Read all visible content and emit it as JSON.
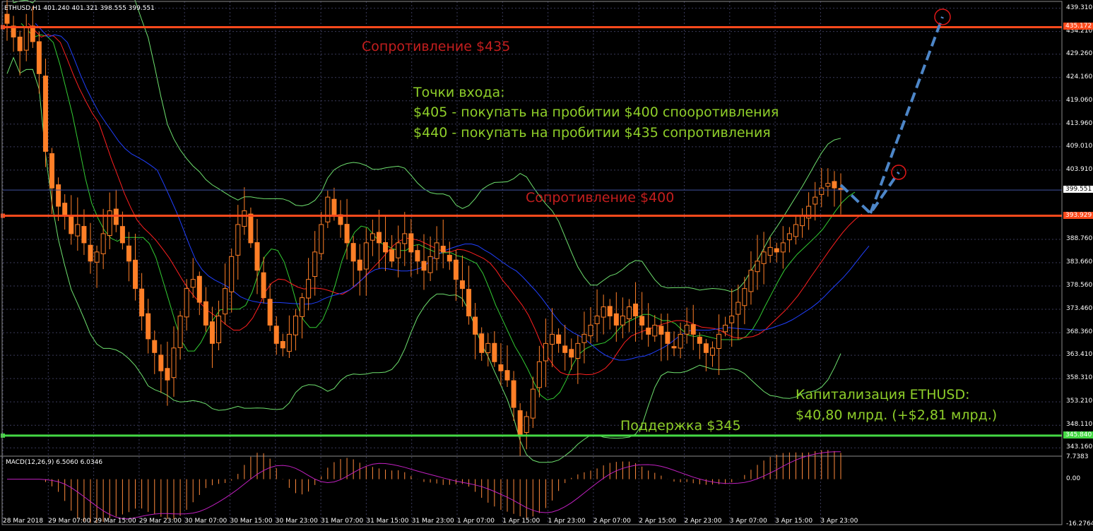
{
  "header": {
    "symbol": "ETHUSD,H1",
    "ohlc": "401.240 401.321 398.555 399.551"
  },
  "macd_label": "MACD(12,26,9) 6.5060 6.0346",
  "annotations": {
    "resistance_435": "Сопротивление $435",
    "entry_title": "Точки входа:",
    "entry_1": "$405 - покупать на пробитии $400 спооротивления",
    "entry_2": "$440 - покупать на пробитии $435 сопротивления",
    "resistance_400": "Сопротивление $400",
    "support_345": "Поддержка $345",
    "cap_title": "Капитализация ETHUSD:",
    "cap_value": "$40,80 млрд. (+$2,81 млрд.)"
  },
  "price_axis": [
    "439.310",
    "434.210",
    "429.260",
    "424.160",
    "419.060",
    "413.960",
    "409.010",
    "403.910",
    "388.760",
    "383.660",
    "378.560",
    "373.460",
    "368.360",
    "363.410",
    "358.310",
    "353.210",
    "348.110",
    "343.160"
  ],
  "level_labels": {
    "resistance_435": "435.172",
    "current": "399.551",
    "resistance_400": "393.929",
    "support_345": "345.840"
  },
  "macd_axis": [
    "7.7383",
    "0.00",
    "-16.2764"
  ],
  "time_axis": [
    "28 Mar 2018",
    "29 Mar 07:00",
    "29 Mar 15:00",
    "29 Mar 23:00",
    "30 Mar 07:00",
    "30 Mar 15:00",
    "30 Mar 23:00",
    "31 Mar 07:00",
    "31 Mar 15:00",
    "31 Mar 23:00",
    "1 Apr 07:00",
    "1 Apr 15:00",
    "1 Apr 23:00",
    "2 Apr 07:00",
    "2 Apr 15:00",
    "2 Apr 23:00",
    "3 Apr 07:00",
    "3 Apr 15:00",
    "3 Apr 23:00"
  ],
  "chart_data": {
    "type": "candlestick",
    "symbol": "ETHUSD",
    "timeframe": "H1",
    "ylim": [
      341.5,
      440.8
    ],
    "close_path": [
      436,
      433,
      430,
      435,
      432,
      425,
      408,
      400,
      396,
      394,
      390,
      392,
      388,
      384,
      386,
      390,
      395,
      392,
      388,
      384,
      378,
      372,
      367,
      364,
      360,
      358,
      365,
      372,
      378,
      380,
      375,
      370,
      366,
      372,
      378,
      385,
      392,
      395,
      388,
      382,
      376,
      370,
      366,
      365,
      368,
      372,
      376,
      380,
      386,
      392,
      398,
      394,
      392,
      388,
      384,
      382,
      388,
      390,
      388,
      386,
      384,
      388,
      390,
      386,
      384,
      382,
      385,
      388,
      386,
      384,
      380,
      378,
      372,
      368,
      364,
      366,
      362,
      360,
      358,
      352,
      346,
      350,
      356,
      362,
      366,
      368,
      366,
      364,
      363,
      366,
      368,
      370,
      372,
      374,
      372,
      370,
      372,
      374,
      372,
      370,
      368,
      370,
      368,
      366,
      365,
      368,
      370,
      368,
      366,
      364,
      365,
      368,
      370,
      372,
      375,
      378,
      382,
      384,
      386,
      387,
      386,
      388,
      390,
      392,
      394,
      396,
      398,
      400,
      401,
      400,
      399.55
    ],
    "moving_averages": [
      "red",
      "blue",
      "green"
    ],
    "bollinger_bands": true,
    "levels": [
      {
        "name": "Сопротивление $435",
        "price": 435.172,
        "color": "#ff4a1c"
      },
      {
        "name": "Сопротивление $400",
        "price": 393.929,
        "color": "#ff4a1c"
      },
      {
        "name": "Поддержка $345",
        "price": 345.84,
        "color": "#44d844"
      }
    ],
    "current_price": 399.551,
    "macd": {
      "ylim": [
        -16.2764,
        7.7383
      ],
      "last": 6.506,
      "signal": 6.0346
    }
  },
  "colors": {
    "bull": "#000000",
    "bear": "#ff7f27",
    "resistance": "#ff4a1c",
    "support": "#44d844",
    "text_red": "#c41e1e",
    "text_green": "#8fcf2a",
    "dashed_arrow": "#4d86c8"
  }
}
